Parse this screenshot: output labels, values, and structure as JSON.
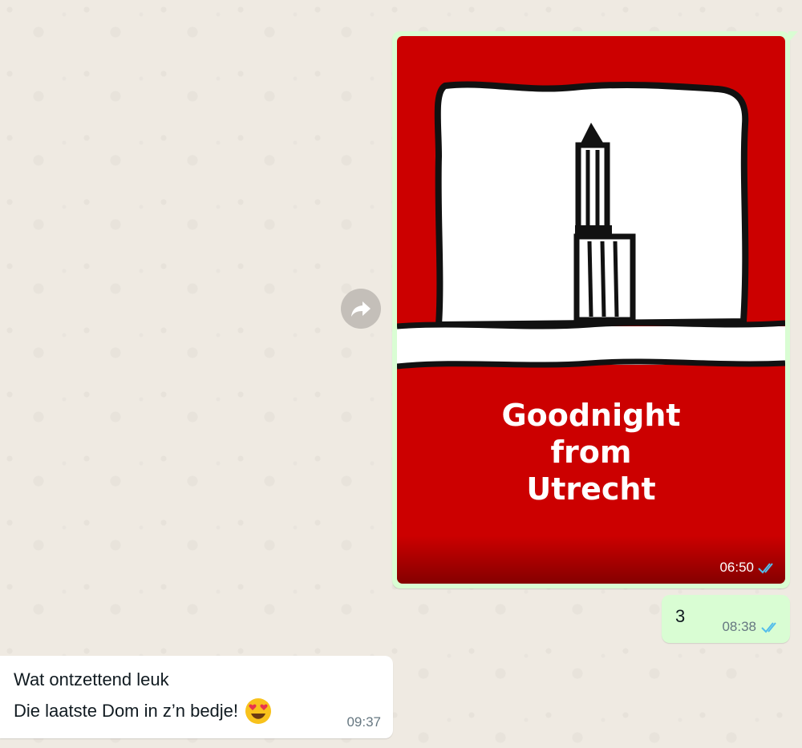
{
  "conversation": {
    "messages": [
      {
        "direction": "outgoing",
        "type": "image",
        "image_text_lines": [
          "Goodnight",
          "from",
          "Utrecht"
        ],
        "time": "06:50",
        "status_icon": "double-check-read-icon"
      },
      {
        "direction": "outgoing",
        "type": "text",
        "text": "3",
        "time": "08:38",
        "status_icon": "double-check-read-icon"
      },
      {
        "direction": "incoming",
        "type": "text",
        "lines": [
          "Wat ontzettend leuk",
          "Die laatste Dom in z’n bedje!"
        ],
        "emoji": "heart-eyes-emoji",
        "time": "09:37"
      }
    ],
    "forward_icon": "forward-icon"
  },
  "colors": {
    "chat_background": "#efeae2",
    "outgoing_bubble": "#d9fdd3",
    "incoming_bubble": "#ffffff",
    "read_tick_blue": "#53bdeb",
    "card_red": "#cc0000",
    "meta_gray": "#667781"
  }
}
